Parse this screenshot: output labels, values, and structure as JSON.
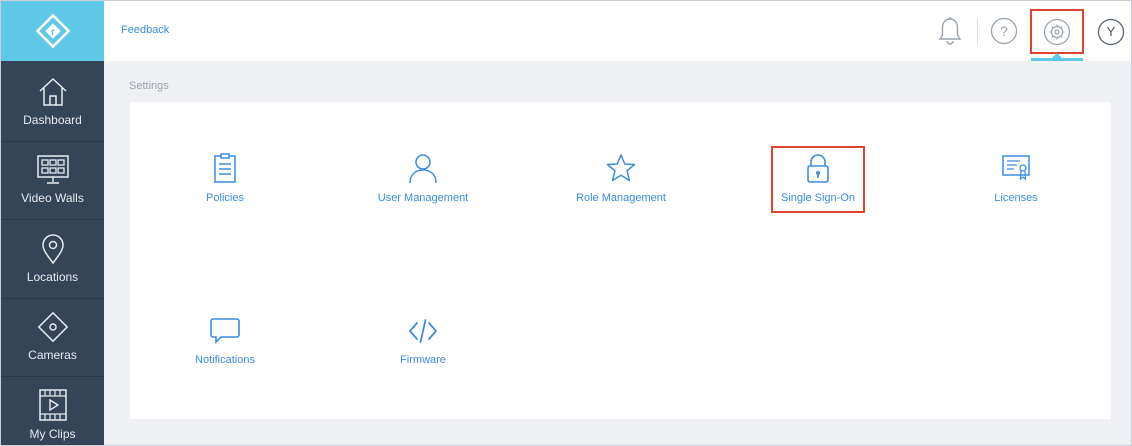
{
  "header": {
    "feedback_label": "Feedback",
    "avatar_initial": "Y"
  },
  "sidebar": {
    "items": [
      {
        "label": "Dashboard",
        "icon": "home-icon"
      },
      {
        "label": "Video Walls",
        "icon": "video-wall-icon"
      },
      {
        "label": "Locations",
        "icon": "location-pin-icon"
      },
      {
        "label": "Cameras",
        "icon": "camera-diamond-icon"
      },
      {
        "label": "My Clips",
        "icon": "film-clip-icon"
      }
    ]
  },
  "main": {
    "breadcrumb": "Settings",
    "tiles": [
      {
        "label": "Policies",
        "icon": "clipboard-icon"
      },
      {
        "label": "User Management",
        "icon": "user-icon"
      },
      {
        "label": "Role Management",
        "icon": "star-icon"
      },
      {
        "label": "Single Sign-On",
        "icon": "lock-icon"
      },
      {
        "label": "Licenses",
        "icon": "certificate-icon"
      },
      {
        "label": "Notifications",
        "icon": "chat-bubble-icon"
      },
      {
        "label": "Firmware",
        "icon": "code-icon"
      }
    ]
  },
  "colors": {
    "sidebar_bg": "#364457",
    "brand_accent": "#5ec8e6",
    "link_blue": "#3a8de0",
    "highlight_red": "#e0442f",
    "content_bg": "#eef0f3"
  }
}
